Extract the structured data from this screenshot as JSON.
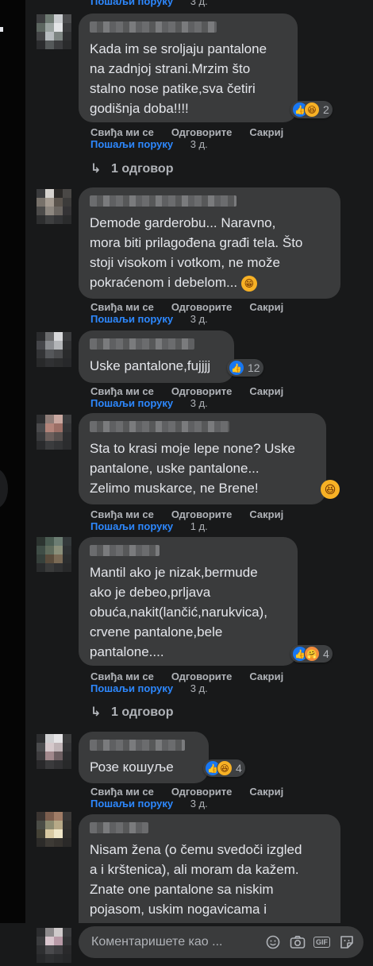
{
  "actions": {
    "like": "Свиђа ми се",
    "reply": "Одговорите",
    "hide": "Сакриј",
    "send": "Пошаљи поруку"
  },
  "top_partial": {
    "time": "3 д."
  },
  "comments": [
    {
      "text": "Kada im se sroljaju pantalone\nna zadnjoj strani.Mrzim što\nstalno nose patike,sva četiri\ngodišnja doba!!!!",
      "reactions": "2",
      "time": "3 д.",
      "replies": "1 одговор"
    },
    {
      "text": "Demode garderobu... Naravno,\nmora biti prilagođena građi tela. Što\nstoji visokom i votkom, ne može\npokraćenom i debelom...",
      "time": "3 д."
    },
    {
      "text": "Uske pantalone,fujjjj",
      "reactions": "12",
      "time": "3 д."
    },
    {
      "text": "Sta to krasi moje lepe none? Uske\npantalone, uske pantalone...\nZelimo muskarce, ne Brene!",
      "time": "1 д."
    },
    {
      "text": "Mantil ako je nizak,bermude\nako je debeo,prljava\nobuća,nakit(lančić,narukvica),\ncrvene pantalone,bele\npantalone....",
      "reactions": "4",
      "time": "3 д.",
      "replies": "1 одговор"
    },
    {
      "text": "Розе кошуље",
      "reactions": "4",
      "time": "3 д."
    },
    {
      "text": "Nisam žena (o čemu svedoči izgled\na i krštenica), ali moram da kažem.\nZnate one pantalone sa niskim\npojasom, uskim nogavicama i\n\"turom\" koji visi? E to me nervira"
    }
  ],
  "composer": {
    "placeholder": "Коментаришете као ..."
  },
  "icons": [
    "like-icon",
    "haha-icon",
    "reply-arrow-icon",
    "emoji-icon",
    "camera-icon",
    "gif-icon",
    "sticker-icon"
  ],
  "colors": {
    "background": "#18191a",
    "bubble": "#3a3b3c",
    "link": "#2d88ff",
    "muted": "#b0b3b8",
    "text": "#e4e6eb"
  }
}
